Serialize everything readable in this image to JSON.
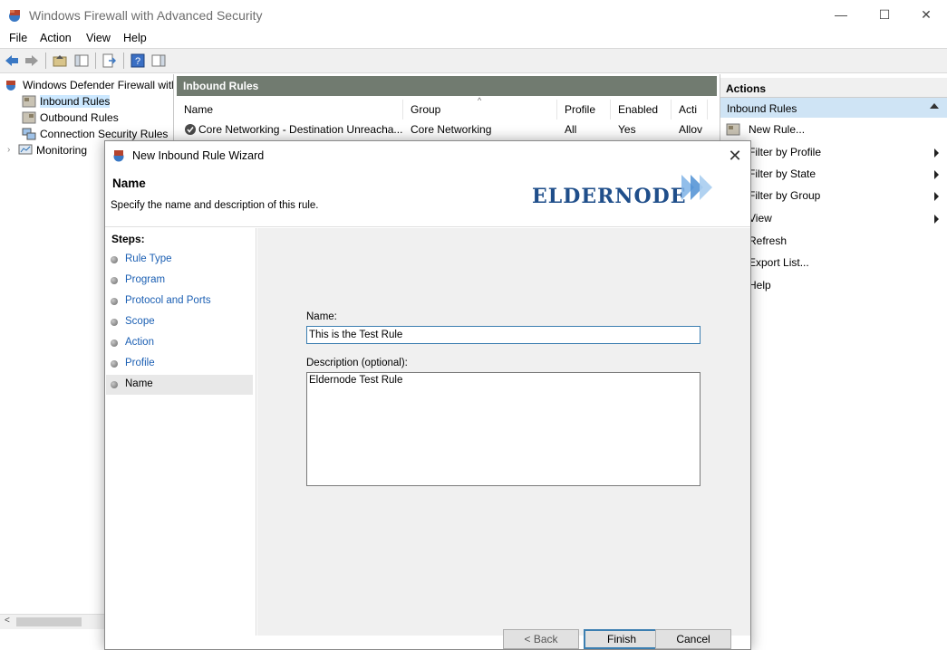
{
  "window": {
    "title": "Windows Firewall with Advanced Security",
    "minimize": "—",
    "maximize": "☐",
    "close": "✕"
  },
  "menu": [
    "File",
    "Action",
    "View",
    "Help"
  ],
  "tree": {
    "root": "Windows Defender Firewall witl",
    "items": [
      "Inbound Rules",
      "Outbound Rules",
      "Connection Security Rules",
      "Monitoring"
    ]
  },
  "center": {
    "header": "Inbound Rules",
    "columns": [
      "Name",
      "Group",
      "Profile",
      "Enabled",
      "Acti"
    ],
    "row": {
      "name": "Core Networking - Destination Unreacha...",
      "group": "Core Networking",
      "profile": "All",
      "enabled": "Yes",
      "action": "Allov"
    }
  },
  "actions": {
    "header": "Actions",
    "section": "Inbound Rules",
    "items": [
      {
        "label": "New Rule...",
        "submenu": false
      },
      {
        "label": "Filter by Profile",
        "submenu": true
      },
      {
        "label": "Filter by State",
        "submenu": true
      },
      {
        "label": "Filter by Group",
        "submenu": true
      },
      {
        "label": "View",
        "submenu": true
      },
      {
        "label": "Refresh",
        "submenu": false
      },
      {
        "label": "Export List...",
        "submenu": false
      },
      {
        "label": "Help",
        "submenu": false
      }
    ]
  },
  "dialog": {
    "title": "New Inbound Rule Wizard",
    "close": "✕",
    "heading": "Name",
    "subtitle": "Specify the name and description of this rule.",
    "logo": "eldernode",
    "steps_title": "Steps:",
    "steps": [
      "Rule Type",
      "Program",
      "Protocol and Ports",
      "Scope",
      "Action",
      "Profile",
      "Name"
    ],
    "current_step": "Name",
    "name_label": "Name:",
    "name_value": "This is the Test Rule",
    "desc_label": "Description (optional):",
    "desc_value": "Eldernode Test Rule",
    "buttons": {
      "back": "< Back",
      "finish": "Finish",
      "cancel": "Cancel"
    }
  },
  "colors": {
    "pane_header": "#717b70",
    "selection": "#cfe4f5",
    "link": "#1b5fb3",
    "logo": "#1f4e8a"
  }
}
